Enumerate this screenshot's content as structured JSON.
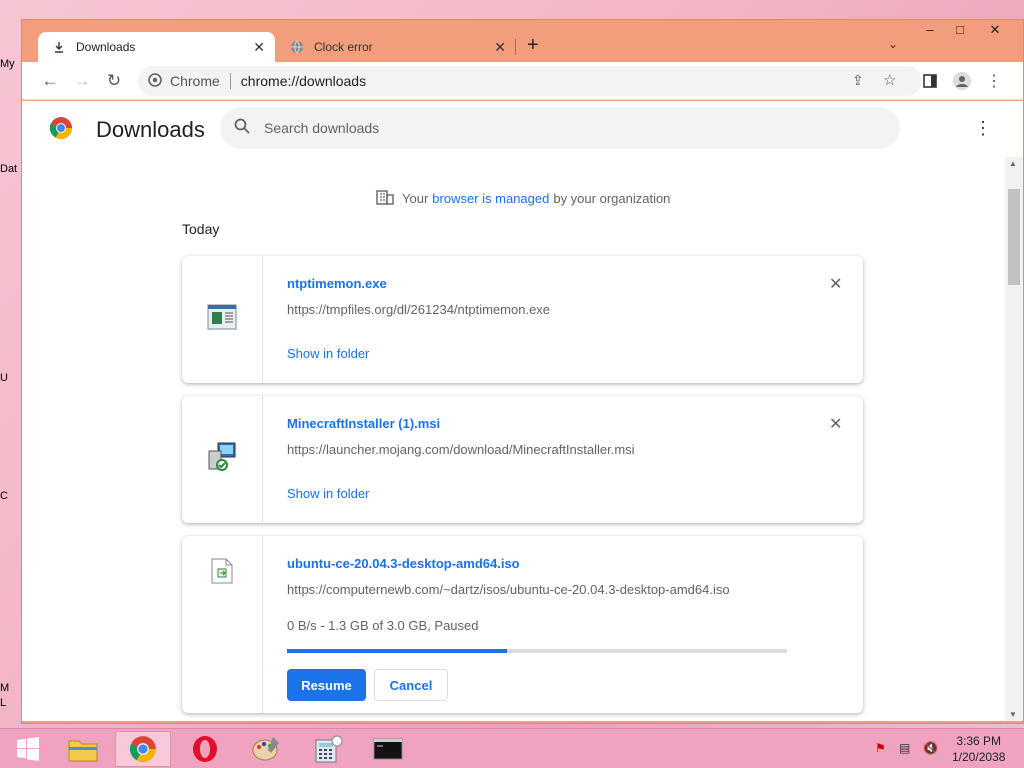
{
  "desktop": {
    "icons": [
      "My",
      "Dat",
      "U",
      "C",
      "L",
      "M",
      "L"
    ]
  },
  "window": {
    "tabs": [
      {
        "label": "Downloads",
        "icon": "download-icon",
        "active": true
      },
      {
        "label": "Clock error",
        "icon": "globe-icon",
        "active": false
      }
    ],
    "controls": {
      "minimize": "–",
      "maximize": "□",
      "close": "✕"
    }
  },
  "toolbar": {
    "site_label": "Chrome",
    "url": "chrome://downloads"
  },
  "page": {
    "title": "Downloads",
    "search_placeholder": "Search downloads",
    "managed": {
      "prefix": "Your",
      "link": "browser is managed",
      "suffix": "by your organization"
    },
    "section_label": "Today"
  },
  "downloads": [
    {
      "file_name": "ntptimemon.exe",
      "url": "https://tmpfiles.org/dl/261234/ntptimemon.exe",
      "action": "Show in folder",
      "icon": "exe-icon"
    },
    {
      "file_name": "MinecraftInstaller (1).msi",
      "url": "https://launcher.mojang.com/download/MinecraftInstaller.msi",
      "action": "Show in folder",
      "icon": "msi-installer-icon"
    },
    {
      "file_name": "ubuntu-ce-20.04.3-desktop-amd64.iso",
      "url": "https://computernewb.com/~dartz/isos/ubuntu-ce-20.04.3-desktop-amd64.iso",
      "status": "0 B/s - 1.3 GB of 3.0 GB, Paused",
      "progress_fraction": 0.44,
      "resume_label": "Resume",
      "cancel_label": "Cancel",
      "icon": "iso-file-icon"
    }
  ],
  "taskbar": {
    "time": "3:36 PM",
    "date": "1/20/2038",
    "apps": [
      "start-icon",
      "file-explorer-icon",
      "chrome-icon",
      "opera-icon",
      "paint-icon",
      "calculator-icon",
      "terminal-icon"
    ]
  },
  "colors": {
    "accent": "#1a73e8",
    "frame": "#f29e7c",
    "taskbar": "#f0a3c0"
  }
}
